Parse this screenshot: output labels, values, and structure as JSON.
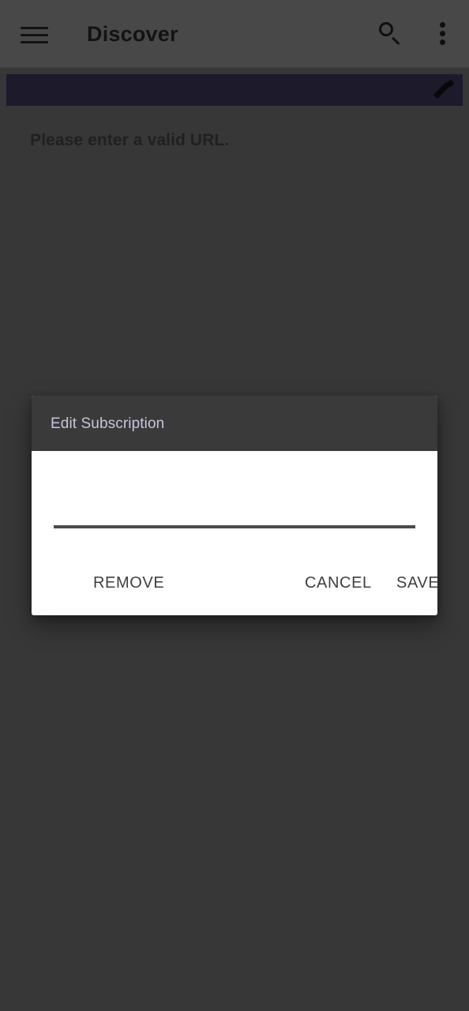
{
  "app_bar": {
    "title": "Discover",
    "menu_icon": "hamburger-menu-icon",
    "search_icon": "search-icon",
    "overflow_icon": "overflow-menu-icon"
  },
  "banner": {
    "value": "",
    "edit_icon": "edit-pencil-icon",
    "color": "#2c2741"
  },
  "content": {
    "status_message": "Please enter a valid URL."
  },
  "dialog": {
    "title": "Edit Subscription",
    "header_color": "#3a3a3a",
    "title_color": "#c8c4dc",
    "url_field": {
      "value": "",
      "placeholder": ""
    },
    "buttons": {
      "remove": "REMOVE",
      "cancel": "CANCEL",
      "save": "SAVE"
    }
  }
}
